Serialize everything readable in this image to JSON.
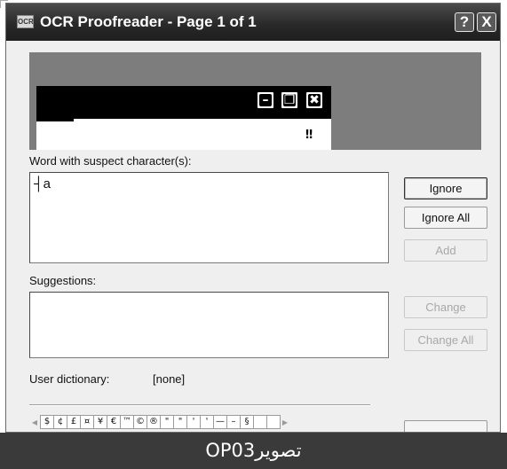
{
  "window": {
    "title": "OCR Proofreader - Page 1 of 1",
    "title_icon": "OCR",
    "help_button": "?",
    "close_button": "X"
  },
  "preview": {
    "mark": "‼"
  },
  "suspect": {
    "label": "Word with suspect character(s):",
    "word": "┤a"
  },
  "suggestions": {
    "label": "Suggestions:"
  },
  "buttons": {
    "ignore": "Ignore",
    "ignore_all": "Ignore All",
    "add": "Add",
    "change": "Change",
    "change_all": "Change All"
  },
  "dictionary": {
    "label": "User dictionary:",
    "value": "[none]"
  },
  "special_chars": [
    "$",
    "¢",
    "£",
    "¤",
    "¥",
    "€",
    "™",
    "©",
    "®",
    "\"",
    "\"",
    "'",
    "'",
    "—",
    "–",
    "§",
    "",
    ""
  ],
  "caption": "OP03تصویر"
}
